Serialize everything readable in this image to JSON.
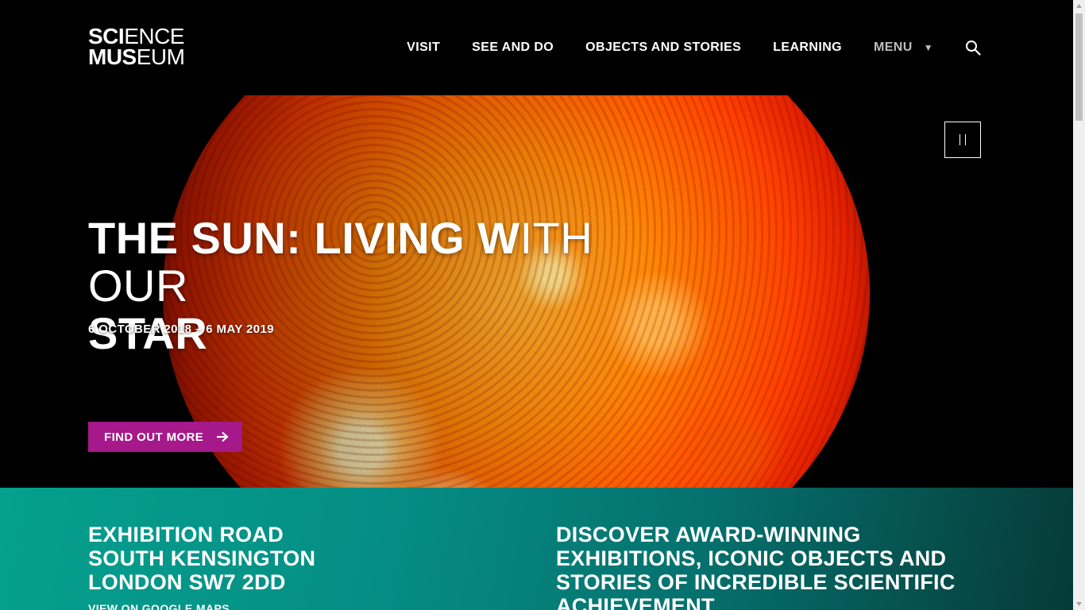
{
  "logo": {
    "line1_bold": "SCI",
    "line1_light": "ENCE",
    "line2_bold": "MUS",
    "line2_light": "EUM"
  },
  "nav": {
    "items": [
      {
        "label": "VISIT"
      },
      {
        "label": "SEE AND DO"
      },
      {
        "label": "OBJECTS AND STORIES"
      },
      {
        "label": "LEARNING"
      }
    ],
    "menu_label": "MENU",
    "menu_caret": "▼"
  },
  "hero": {
    "title_bold": "THE SUN:",
    "title_mid": " LIVING W",
    "title_light": "ITH OUR",
    "title_line2": "STAR",
    "dates": "6 OCTOBER 2018 – 6 MAY 2019",
    "cta_label": "FIND OUT MORE"
  },
  "info": {
    "address": [
      "EXHIBITION ROAD",
      "SOUTH KENSINGTON",
      "LONDON SW7 2DD"
    ],
    "maps_link": "VIEW ON GOOGLE MAPS",
    "tagline": "DISCOVER AWARD-WINNING EXHIBITIONS, ICONIC OBJECTS AND STORIES OF INCREDIBLE SCIENTIFIC ACHIEVEMENT"
  },
  "colors": {
    "header_bg": "#000000",
    "cta_bg": "#a5198a",
    "band_teal": "#05a08e",
    "menu_grey": "#bdbdbd"
  }
}
